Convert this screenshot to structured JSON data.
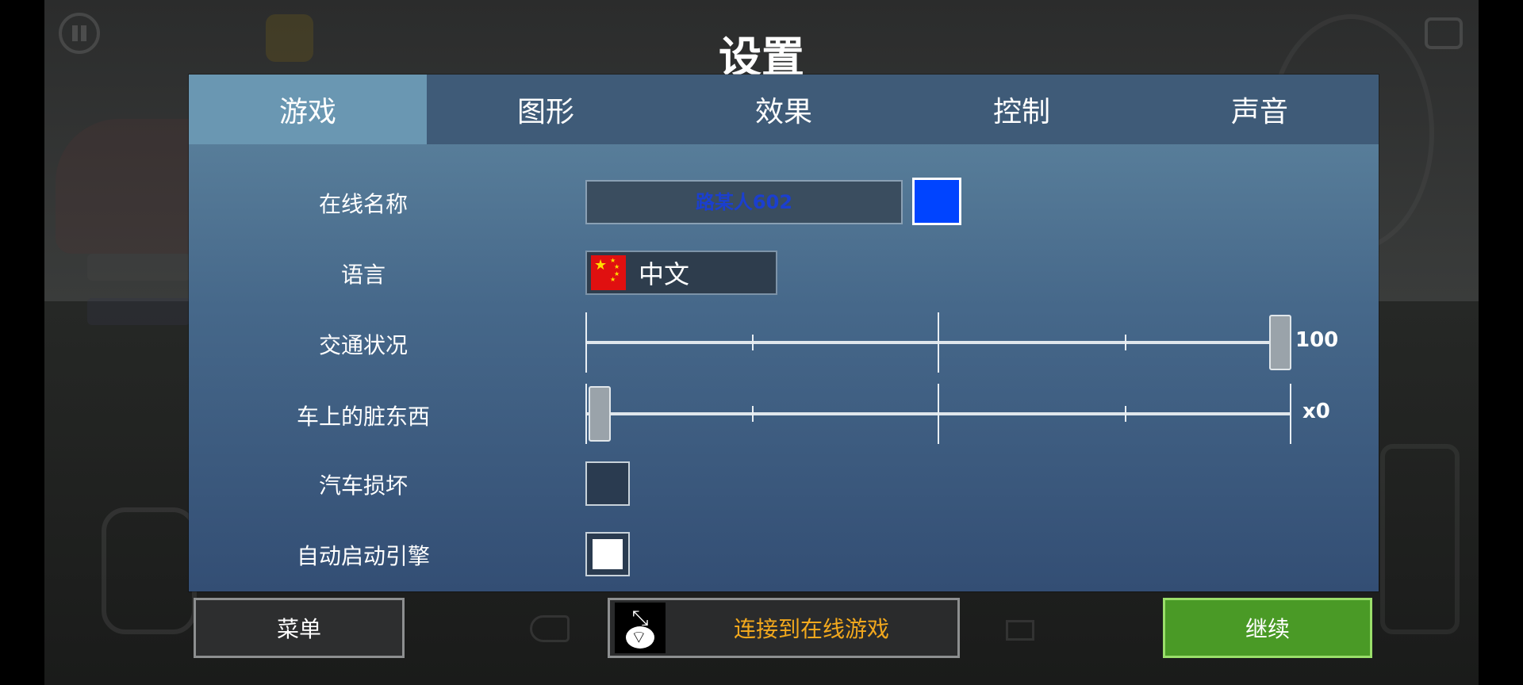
{
  "title": "设置",
  "tabs": [
    {
      "label": "游戏",
      "active": true
    },
    {
      "label": "图形",
      "active": false
    },
    {
      "label": "效果",
      "active": false
    },
    {
      "label": "控制",
      "active": false
    },
    {
      "label": "声音",
      "active": false
    }
  ],
  "settings": {
    "online_name": {
      "label": "在线名称",
      "value": "路某人602",
      "color": "#0044ff"
    },
    "language": {
      "label": "语言",
      "value": "中文",
      "flag": "china-flag-icon"
    },
    "traffic": {
      "label": "交通状况",
      "value": 100,
      "value_text": "100"
    },
    "car_dirt": {
      "label": "车上的脏东西",
      "value": 0,
      "value_text": "x0"
    },
    "car_damage": {
      "label": "汽车损坏",
      "checked": false
    },
    "auto_start_engine": {
      "label": "自动启动引擎",
      "checked": true
    }
  },
  "bottom_bar": {
    "menu_label": "菜单",
    "online_label": "连接到在线游戏",
    "online_icon": "network-wifi-icon",
    "continue_label": "继续"
  },
  "colors": {
    "panel_top": "#5f86a0",
    "panel_bottom": "#334e74",
    "active_tab": "#6a97b2",
    "continue_button": "#4a9a26",
    "online_text": "#f2a81d"
  }
}
